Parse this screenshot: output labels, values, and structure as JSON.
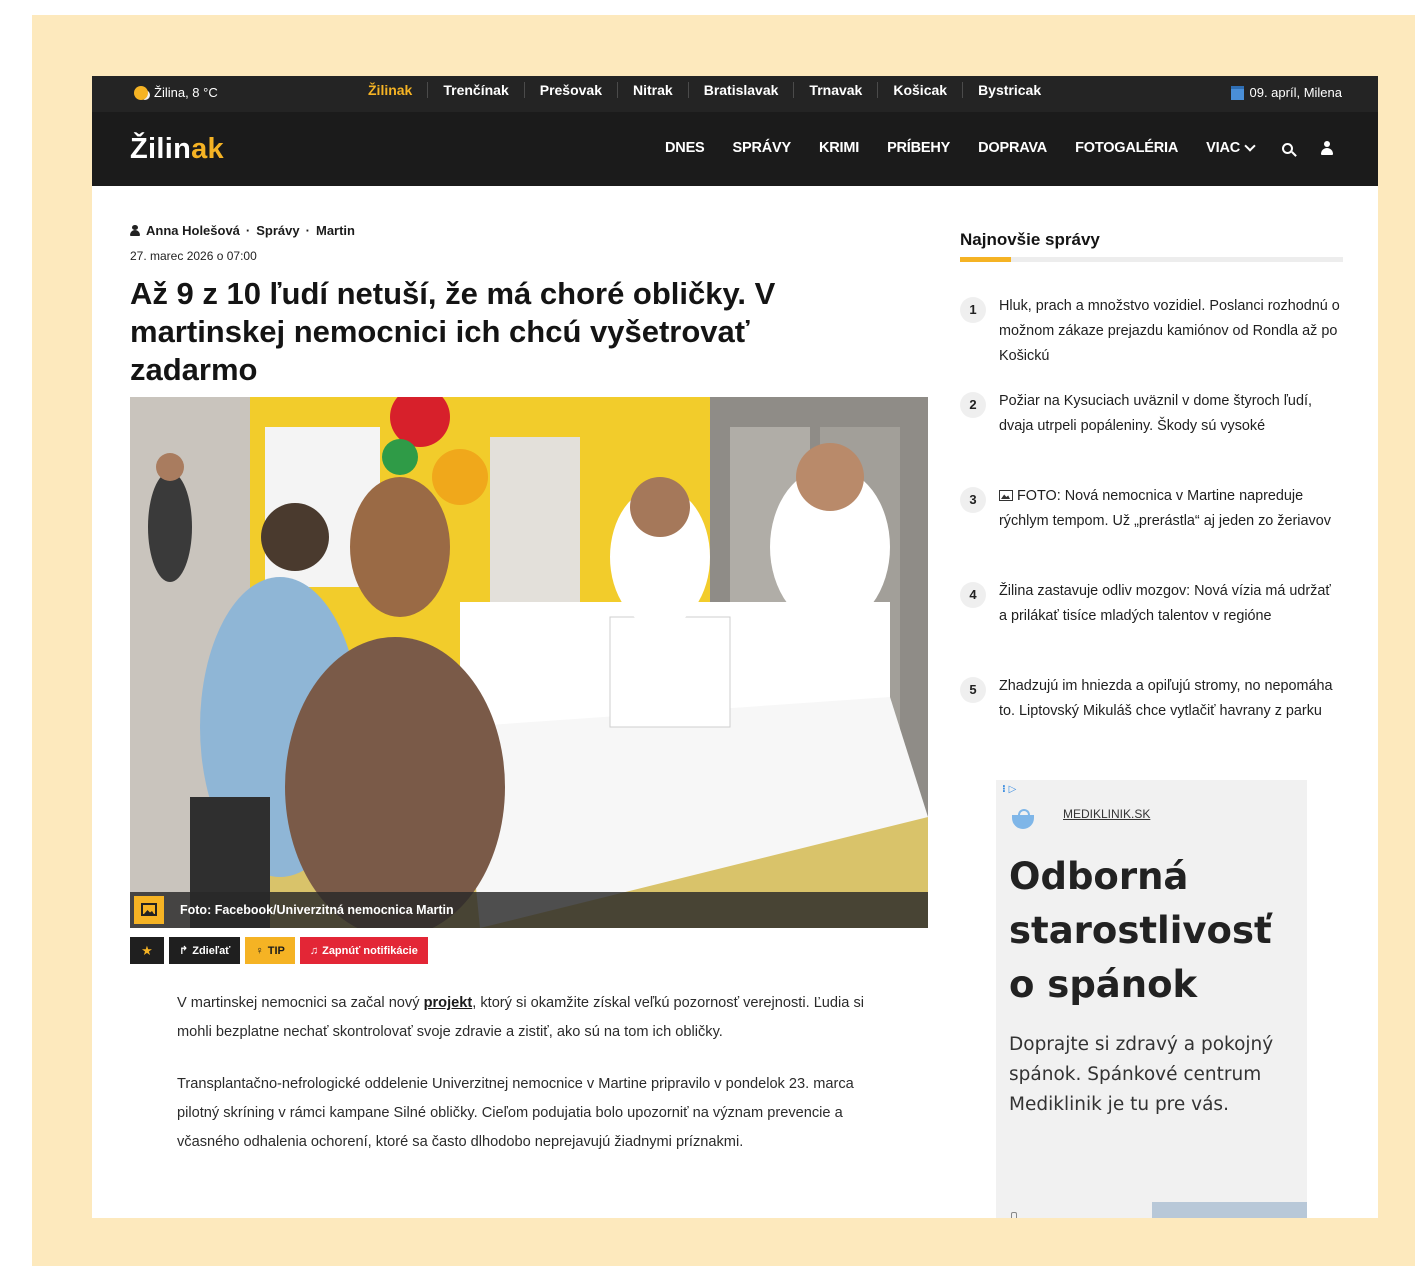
{
  "topbar": {
    "weather": "Žilina, 8 °C",
    "regions": [
      "Žilinak",
      "Trenčínak",
      "Prešovak",
      "Nitrak",
      "Bratislavak",
      "Trnavak",
      "Košicak",
      "Bystricak"
    ],
    "date": "09. apríl, Milena"
  },
  "header": {
    "logo_main": "Žilin",
    "logo_accent": "ak",
    "nav": [
      "DNES",
      "SPRÁVY",
      "KRIMI",
      "PRÍBEHY",
      "DOPRAVA",
      "FOTOGALÉRIA"
    ],
    "more": "VIAC"
  },
  "article": {
    "author": "Anna Holešová",
    "category": "Správy",
    "location": "Martin",
    "date": "27. marec 2026 o 07:00",
    "title": "Až 9 z 10 ľudí netuší, že má choré obličky. V martinskej nemocnici ich chcú vyšetrovať zadarmo",
    "photo_caption": "Foto: Facebook/Univerzitná nemocnica Martin",
    "actions": {
      "share": "Zdieľať",
      "tip": "TIP",
      "notify": "Zapnúť notifikácie"
    },
    "p1_before": "V martinskej nemocnici sa začal nový ",
    "p1_link": "projekt",
    "p1_after": ", ktorý si okamžite získal veľkú pozornosť verejnosti. Ľudia si mohli bezplatne nechať skontrolovať svoje zdravie a zistiť, ako sú na tom ich obličky.",
    "p2": "Transplantačno-nefrologické oddelenie Univerzitnej nemocnice v Martine pripravilo v pondelok 23. marca pilotný skríning v rámci kampane Silné obličky. Cieľom podujatia bolo upozorniť na význam prevencie a včasného odhalenia ochorení, ktoré sa často dlhodobo neprejavujú žiadnymi príznakmi."
  },
  "sidebar": {
    "title": "Najnovšie správy",
    "news": [
      {
        "num": "1",
        "text": "Hluk, prach a množstvo vozidiel. Poslanci rozhodnú o možnom zákaze prejazdu kamiónov od Rondla až po Košickú"
      },
      {
        "num": "2",
        "text": "Požiar na Kysuciach uväznil v dome štyroch ľudí, dvaja utrpeli popáleniny. Škody sú vysoké"
      },
      {
        "num": "3",
        "text": "FOTO: Nová nemocnica v Martine napreduje rýchlym tempom. Už „prerástla“ aj jeden zo žeriavov"
      },
      {
        "num": "4",
        "text": "Žilina zastavuje odliv mozgov: Nová vízia má udržať a prilákať tisíce mladých talentov v regióne"
      },
      {
        "num": "5",
        "text": "Zhadzujú im hniezda a opiľujú stromy, no nepomáha to. Liptovský Mikuláš chce vytlačiť havrany z parku"
      }
    ],
    "ad": {
      "domain": "MEDIKLINIK.SK",
      "headline": "Odborná starostlivosť o spánok",
      "body": "Doprajte si zdravý a pokojný spánok. Spánkové centrum Mediklinik je tu pre vás."
    }
  }
}
